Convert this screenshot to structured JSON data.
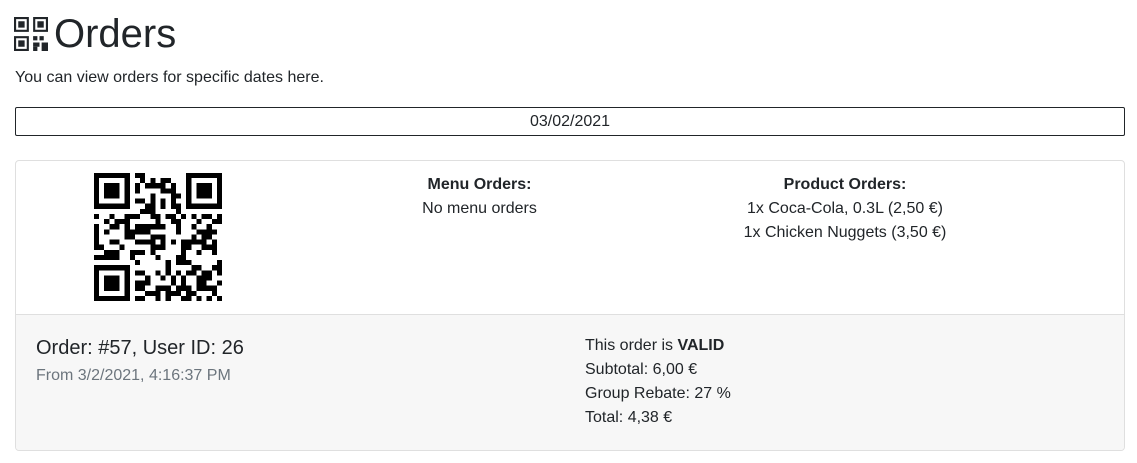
{
  "page": {
    "title": "Orders",
    "description": "You can view orders for specific dates here.",
    "icon": "qr-code-icon"
  },
  "date_filter": {
    "value": "03/02/2021"
  },
  "order": {
    "menu_orders_heading": "Menu Orders:",
    "menu_orders_empty": "No menu orders",
    "product_orders_heading": "Product Orders:",
    "product_orders": [
      "1x Coca-Cola, 0.3L (2,50 €)",
      "1x Chicken Nuggets (3,50 €)"
    ],
    "title": "Order: #57, User ID: 26",
    "from": "From 3/2/2021, 4:16:37 PM",
    "status_prefix": "This order is ",
    "status": "VALID",
    "subtotal": "Subtotal: 6,00 €",
    "rebate": "Group Rebate: 27 %",
    "total": "Total: 4,38 €"
  }
}
